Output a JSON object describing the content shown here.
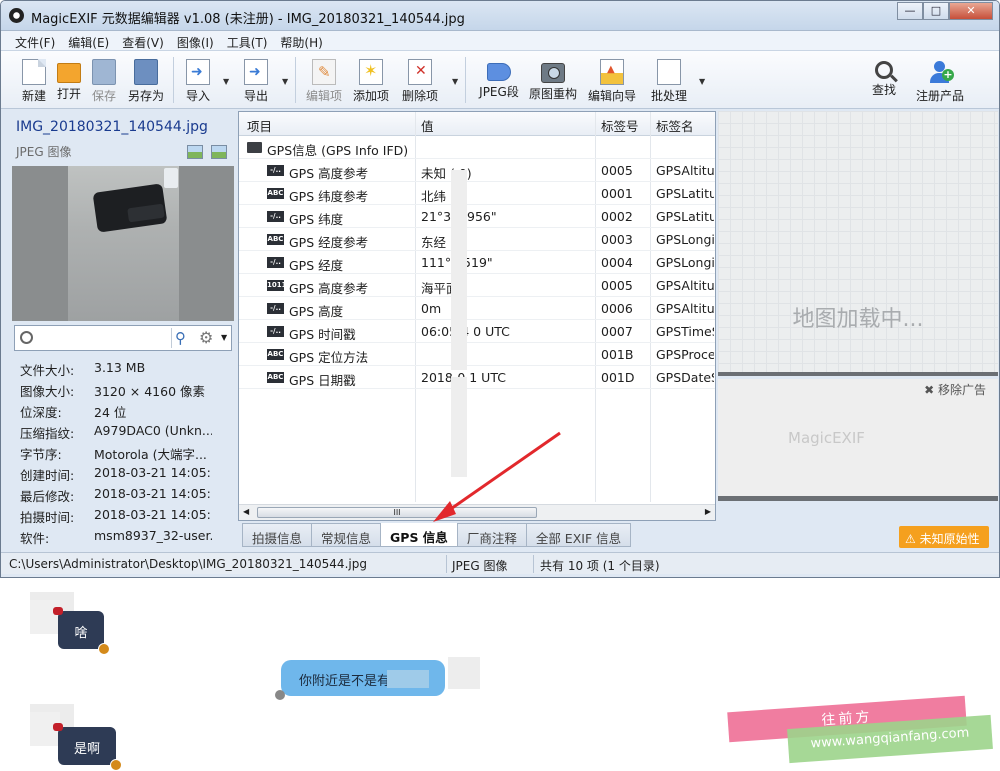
{
  "window": {
    "title": "MagicEXIF 元数据编辑器 v1.08 (未注册) - IMG_20180321_140544.jpg",
    "controls": [
      "—",
      "□",
      "✕"
    ]
  },
  "menu": [
    "文件(F)",
    "编辑(E)",
    "查看(V)",
    "图像(I)",
    "工具(T)",
    "帮助(H)"
  ],
  "toolbar": {
    "new": "新建",
    "open": "打开",
    "save": "保存",
    "save_as": "另存为",
    "import": "导入",
    "export": "导出",
    "edit_item": "编辑项",
    "add_item": "添加项",
    "delete_item": "删除项",
    "jpeg_seg": "JPEG段",
    "rebuild": "原图重构",
    "wizard": "编辑向导",
    "batch": "批处理",
    "find": "查找",
    "register": "注册产品"
  },
  "file": {
    "name": "IMG_20180321_140544.jpg",
    "type": "JPEG 图像"
  },
  "properties": [
    {
      "k": "文件大小:",
      "v": "3.13 MB"
    },
    {
      "k": "图像大小:",
      "v": "3120 × 4160 像素"
    },
    {
      "k": "位深度:",
      "v": "24 位"
    },
    {
      "k": "压缩指纹:",
      "v": "A979DAC0 (Unkn..."
    },
    {
      "k": "字节序:",
      "v": "Motorola (大端字..."
    },
    {
      "k": "创建时间:",
      "v": "2018-03-21 14:05:..."
    },
    {
      "k": "最后修改:",
      "v": "2018-03-21 14:05:..."
    },
    {
      "k": "拍摄时间:",
      "v": "2018-03-21 14:05:..."
    },
    {
      "k": "软件:",
      "v": "msm8937_32-user..."
    }
  ],
  "grid": {
    "headers": [
      "项目",
      "值",
      "标签号",
      "标签名"
    ],
    "group": "GPS信息 (GPS Info IFD)",
    "rows": [
      {
        "icon": "-/..",
        "name": "GPS 高度参考",
        "value": "未知 (   0)",
        "tag": "0005",
        "tagname": "GPSAltitu"
      },
      {
        "icon": "ABC",
        "name": "GPS 纬度参考",
        "value": "北纬",
        "tag": "0001",
        "tagname": "GPSLatitu"
      },
      {
        "icon": "-/..",
        "name": "GPS 纬度",
        "value": "21°3   .3956\"",
        "tag": "0002",
        "tagname": "GPSLatitu"
      },
      {
        "icon": "ABC",
        "name": "GPS 经度参考",
        "value": "东经 (",
        "tag": "0003",
        "tagname": "GPSLongit"
      },
      {
        "icon": "-/..",
        "name": "GPS 经度",
        "value": "111°0    519\"",
        "tag": "0004",
        "tagname": "GPSLongit"
      },
      {
        "icon": "1011",
        "name": "GPS 高度参考",
        "value": "海平面",
        "tag": "0005",
        "tagname": "GPSAltitu"
      },
      {
        "icon": "-/..",
        "name": "GPS 高度",
        "value": "0m",
        "tag": "0006",
        "tagname": "GPSAltitu"
      },
      {
        "icon": "-/..",
        "name": "GPS 时间戳",
        "value": "06:05:4    0 UTC",
        "tag": "0007",
        "tagname": "GPSTimeS"
      },
      {
        "icon": "ABC",
        "name": "GPS 定位方法",
        "value": "",
        "tag": "001B",
        "tagname": "GPSProces"
      },
      {
        "icon": "ABC",
        "name": "GPS 日期戳",
        "value": "2018-0    1 UTC",
        "tag": "001D",
        "tagname": "GPSDateS"
      }
    ],
    "scroll_grip": "III"
  },
  "tabs": [
    "拍摄信息",
    "常规信息",
    "GPS 信息",
    "厂商注释",
    "全部 EXIF 信息"
  ],
  "map": {
    "loading": "地图加载中...",
    "remove_ad": "✖ 移除广告",
    "ad_mark": "MagicEXIF"
  },
  "original_badge": "未知原始性",
  "status": {
    "path": "C:\\Users\\Administrator\\Desktop\\IMG_20180321_140544.jpg",
    "type": "JPEG 图像",
    "count": "共有 10 项 (1 个目录)"
  },
  "chat": {
    "msg1": "啥",
    "msg2": "你附近是不是有",
    "msg3": "是啊",
    "watermark_top": "往前方",
    "watermark_bottom": "www.wangqianfang.com"
  },
  "colors": {
    "accent": "#1a3b8f",
    "badge": "#f5a01e",
    "bubble_dark": "#2e3b55",
    "bubble_blue": "#6fb7eb"
  }
}
